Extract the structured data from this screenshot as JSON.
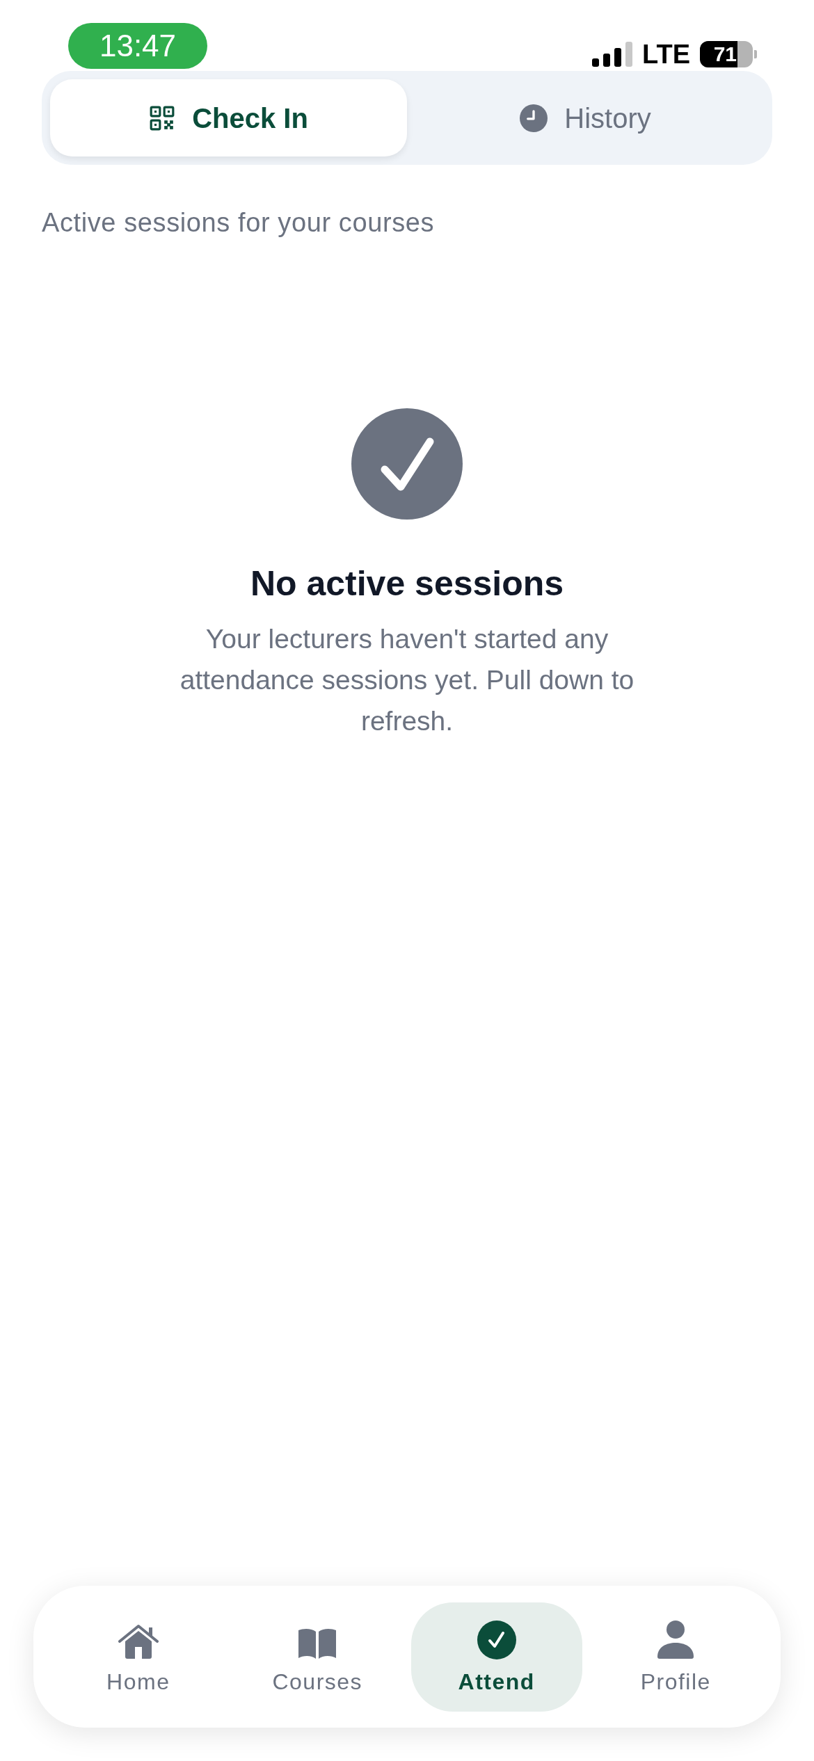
{
  "status_bar": {
    "time": "13:47",
    "network": "LTE",
    "battery": "71"
  },
  "tabs": [
    {
      "label": "Check In",
      "selected": true
    },
    {
      "label": "History",
      "selected": false
    }
  ],
  "subtitle": "Active sessions for your courses",
  "empty_state": {
    "title": "No active sessions",
    "message": "Your lecturers haven't started any attendance sessions yet. Pull down to refresh."
  },
  "bottom_nav": [
    {
      "label": "Home",
      "selected": false
    },
    {
      "label": "Courses",
      "selected": false
    },
    {
      "label": "Attend",
      "selected": true
    },
    {
      "label": "Profile",
      "selected": false
    }
  ]
}
